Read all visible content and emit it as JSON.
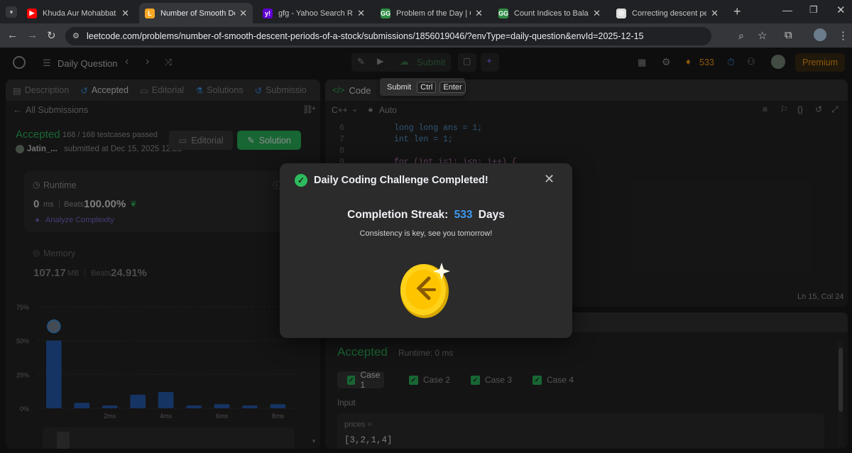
{
  "browser": {
    "tabs": [
      {
        "title": "Khuda Aur Mohabbat - Sea",
        "fav_color": "#ff0000",
        "fav_glyph": "▶",
        "active": false
      },
      {
        "title": "Number of Smooth Descen",
        "fav_color": "#f9a825",
        "fav_glyph": "L",
        "active": true
      },
      {
        "title": "gfg - Yahoo Search Results",
        "fav_color": "#6001d2",
        "fav_glyph": "y!",
        "active": false
      },
      {
        "title": "Problem of the Day | Geek",
        "fav_color": "#2f8d46",
        "fav_glyph": "GG",
        "active": false
      },
      {
        "title": "Count Indices to Balance E",
        "fav_color": "#2f8d46",
        "fav_glyph": "GG",
        "active": false
      },
      {
        "title": "Correcting descent period",
        "fav_color": "#dddddd",
        "fav_glyph": "◎",
        "active": false
      }
    ],
    "url": "leetcode.com/problems/number-of-smooth-descent-periods-of-a-stock/submissions/1856019046/?envType=daily-question&envId=2025-12-15"
  },
  "topbar": {
    "title": "Daily Question",
    "submit_label": "Submit",
    "streak": "533",
    "premium": "Premium",
    "tooltip": {
      "label": "Submit",
      "key1": "Ctrl",
      "key2": "Enter"
    }
  },
  "left": {
    "tabs": [
      "Description",
      "Accepted",
      "Editorial",
      "Solutions",
      "Submissio"
    ],
    "back_label": "All Submissions",
    "status": "Accepted",
    "testcases": "168 / 168 testcases passed",
    "author": "Jatin_...",
    "submitted": "submitted at Dec 15, 2025 12:28",
    "editorial_btn": "Editorial",
    "solution_btn": "Solution",
    "runtime": {
      "label": "Runtime",
      "value": "0",
      "unit": "ms",
      "beats_label": "Beats",
      "beats": "100.00%",
      "analyze": "Analyze Complexity"
    },
    "memory": {
      "label": "Memory",
      "value": "107.17",
      "unit": "MB",
      "beats_label": "Beats",
      "beats": "24.91%"
    }
  },
  "chart_data": {
    "type": "bar",
    "y_ticks": [
      "75%",
      "50%",
      "25%",
      "0%"
    ],
    "ylim": [
      0,
      75
    ],
    "x_ticks": [
      "2ms",
      "4ms",
      "6ms",
      "8ms"
    ],
    "values": [
      50,
      4,
      2,
      10,
      12,
      2,
      3,
      2,
      3
    ],
    "highlight_index": 0,
    "color": "#2860b5"
  },
  "right": {
    "code_tab": "Code",
    "language": "C++",
    "auto": "Auto",
    "lines": [
      {
        "n": "6",
        "text": "long long ans = 1;"
      },
      {
        "n": "7",
        "text": "int len = 1;"
      },
      {
        "n": "8",
        "text": ""
      },
      {
        "n": "9",
        "text": "for (int i=1; i<n; i++) {"
      }
    ],
    "cursor": "Ln 15, Col 24",
    "result": {
      "status": "Accepted",
      "runtime": "Runtime: 0 ms",
      "cases": [
        "Case 1",
        "Case 2",
        "Case 3",
        "Case 4"
      ],
      "input_label": "Input",
      "param": "prices =",
      "value": "[3,2,1,4]"
    }
  },
  "modal": {
    "title": "Daily Coding Challenge Completed!",
    "streak_label": "Completion Streak:",
    "streak_value": "533",
    "streak_unit": "Days",
    "message": "Consistency is key, see you tomorrow!"
  },
  "colors": {
    "accent_green": "#2cbb5d",
    "streak_blue": "#3a9af2",
    "coin_gold": "#ffd21a"
  }
}
